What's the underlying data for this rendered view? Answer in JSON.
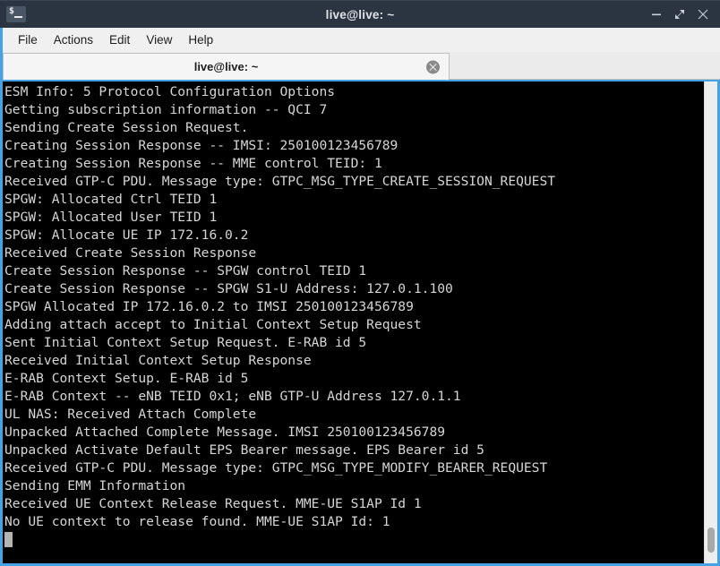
{
  "window": {
    "title": "live@live: ~",
    "icon": "terminal-icon",
    "controls": [
      {
        "name": "minimize-button",
        "glyph": "minimize"
      },
      {
        "name": "maximize-button",
        "glyph": "maximize"
      },
      {
        "name": "close-button",
        "glyph": "close"
      }
    ]
  },
  "menubar": {
    "items": [
      {
        "label": "File"
      },
      {
        "label": "Actions"
      },
      {
        "label": "Edit"
      },
      {
        "label": "View"
      },
      {
        "label": "Help"
      }
    ]
  },
  "tabs": [
    {
      "label": "live@live: ~",
      "active": true,
      "close_icon": "tab-close-icon"
    }
  ],
  "terminal": {
    "lines": [
      "ESM Info: 5 Protocol Configuration Options",
      "Getting subscription information -- QCI 7",
      "Sending Create Session Request.",
      "Creating Session Response -- IMSI: 250100123456789",
      "Creating Session Response -- MME control TEID: 1",
      "Received GTP-C PDU. Message type: GTPC_MSG_TYPE_CREATE_SESSION_REQUEST",
      "SPGW: Allocated Ctrl TEID 1",
      "SPGW: Allocated User TEID 1",
      "SPGW: Allocate UE IP 172.16.0.2",
      "Received Create Session Response",
      "Create Session Response -- SPGW control TEID 1",
      "Create Session Response -- SPGW S1-U Address: 127.0.1.100",
      "SPGW Allocated IP 172.16.0.2 to IMSI 250100123456789",
      "Adding attach accept to Initial Context Setup Request",
      "Sent Initial Context Setup Request. E-RAB id 5",
      "Received Initial Context Setup Response",
      "E-RAB Context Setup. E-RAB id 5",
      "E-RAB Context -- eNB TEID 0x1; eNB GTP-U Address 127.0.1.1",
      "UL NAS: Received Attach Complete",
      "Unpacked Attached Complete Message. IMSI 250100123456789",
      "Unpacked Activate Default EPS Bearer message. EPS Bearer id 5",
      "Received GTP-C PDU. Message type: GTPC_MSG_TYPE_MODIFY_BEARER_REQUEST",
      "Sending EMM Information",
      "Received UE Context Release Request. MME-UE S1AP Id 1",
      "No UE context to release found. MME-UE S1AP Id: 1"
    ],
    "cursor": "block"
  },
  "colors": {
    "titlebar_bg": "#2b3441",
    "accent_border": "#45a3e5",
    "terminal_bg": "#000000",
    "terminal_fg": "#d6d6d6",
    "cursor": "#b4b4b4"
  }
}
